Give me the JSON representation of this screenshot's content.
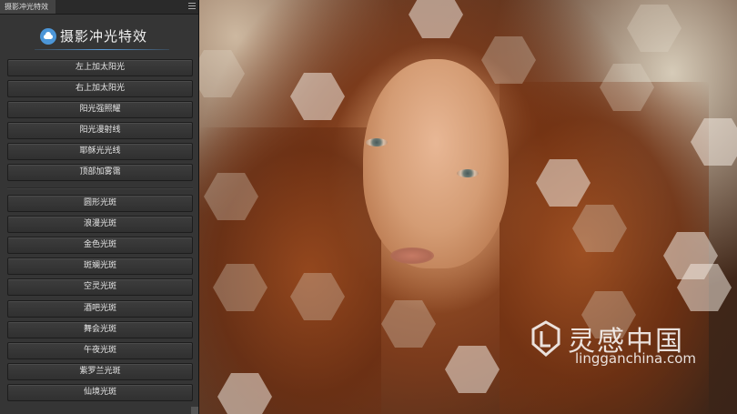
{
  "panel": {
    "tab_title": "摄影冲光特效",
    "header_title": "摄影冲光特效",
    "buttons_group1": [
      "左上加太阳光",
      "右上加太阳光",
      "阳光强照耀",
      "阳光漫射线",
      "耶稣光光线",
      "顶部加雾霭"
    ],
    "buttons_group2": [
      "圆形光斑",
      "浪漫光斑",
      "金色光斑",
      "斑斓光斑",
      "空灵光斑",
      "酒吧光斑",
      "舞会光斑",
      "午夜光斑",
      "紫罗兰光斑",
      "仙境光斑"
    ]
  },
  "watermark": {
    "name": "灵感中国",
    "url": "lingganchina.com"
  },
  "colors": {
    "panel_bg": "#353535",
    "accent": "#4c96d8",
    "button_text": "#e4e4e4"
  }
}
